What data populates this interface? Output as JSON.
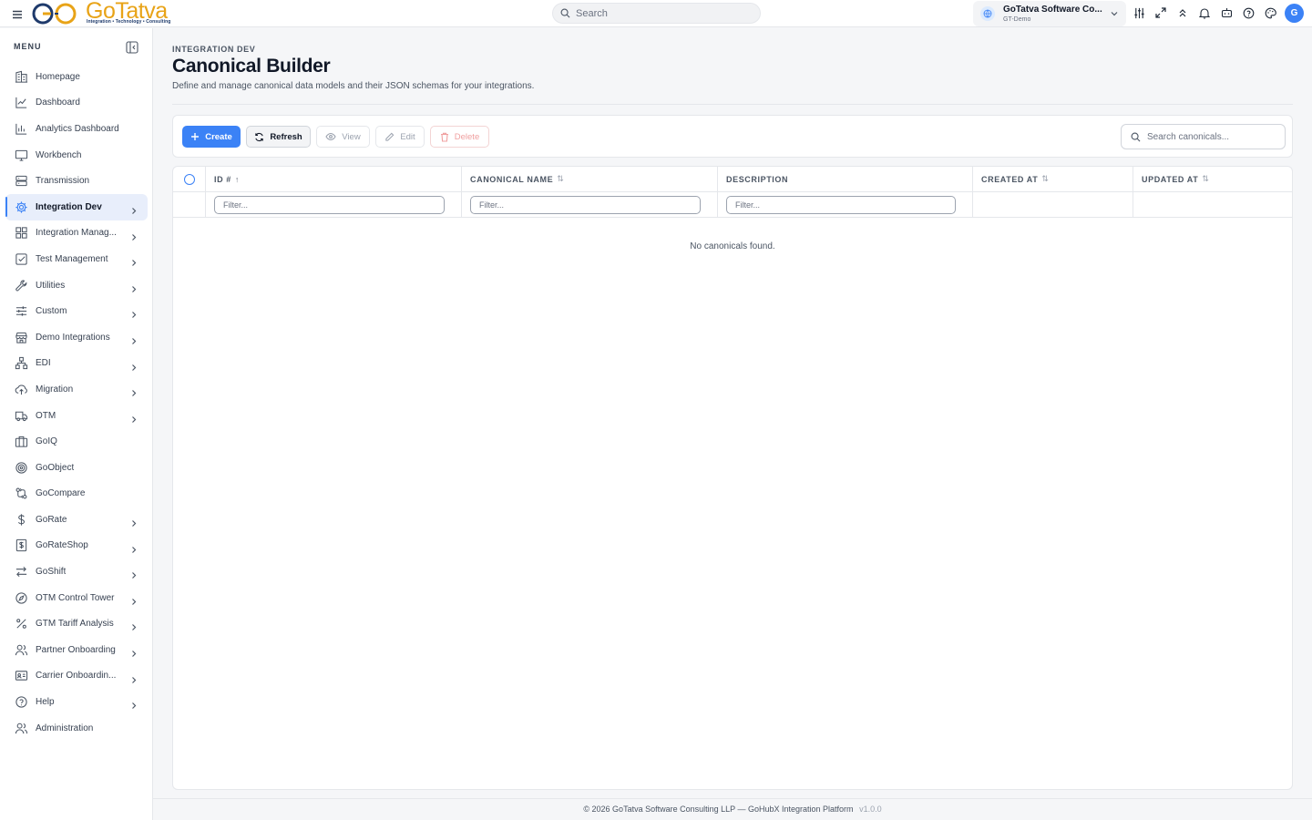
{
  "brand": {
    "name": "GoTatva",
    "tagline": "Integration • Technology • Consulting"
  },
  "header": {
    "search_placeholder": "Search",
    "org_name": "GoTatva Software Co...",
    "org_env": "GT-Demo",
    "avatar_initial": "G",
    "icons": [
      "sliders-icon",
      "expand-icon",
      "chevrons-up-icon",
      "bell-icon",
      "bot-icon",
      "help-icon",
      "palette-icon"
    ]
  },
  "sidebar": {
    "title": "MENU",
    "items": [
      {
        "label": "Homepage",
        "icon": "building-icon",
        "chevron": false,
        "active": false
      },
      {
        "label": "Dashboard",
        "icon": "line-chart-icon",
        "chevron": false,
        "active": false
      },
      {
        "label": "Analytics Dashboard",
        "icon": "bar-chart-icon",
        "chevron": false,
        "active": false
      },
      {
        "label": "Workbench",
        "icon": "monitor-icon",
        "chevron": false,
        "active": false
      },
      {
        "label": "Transmission",
        "icon": "server-icon",
        "chevron": false,
        "active": false
      },
      {
        "label": "Integration Dev",
        "icon": "gear-icon",
        "chevron": true,
        "active": true
      },
      {
        "label": "Integration Manag...",
        "icon": "grid-icon",
        "chevron": true,
        "active": false
      },
      {
        "label": "Test Management",
        "icon": "check-square-icon",
        "chevron": true,
        "active": false
      },
      {
        "label": "Utilities",
        "icon": "wrench-icon",
        "chevron": true,
        "active": false
      },
      {
        "label": "Custom",
        "icon": "sliders-h-icon",
        "chevron": true,
        "active": false
      },
      {
        "label": "Demo Integrations",
        "icon": "store-icon",
        "chevron": true,
        "active": false
      },
      {
        "label": "EDI",
        "icon": "network-icon",
        "chevron": true,
        "active": false
      },
      {
        "label": "Migration",
        "icon": "cloud-upload-icon",
        "chevron": true,
        "active": false
      },
      {
        "label": "OTM",
        "icon": "truck-icon",
        "chevron": true,
        "active": false
      },
      {
        "label": "GoIQ",
        "icon": "briefcase-icon",
        "chevron": false,
        "active": false
      },
      {
        "label": "GoObject",
        "icon": "target-icon",
        "chevron": false,
        "active": false
      },
      {
        "label": "GoCompare",
        "icon": "git-compare-icon",
        "chevron": false,
        "active": false
      },
      {
        "label": "GoRate",
        "icon": "dollar-icon",
        "chevron": true,
        "active": false
      },
      {
        "label": "GoRateShop",
        "icon": "receipt-dollar-icon",
        "chevron": true,
        "active": false
      },
      {
        "label": "GoShift",
        "icon": "arrows-swap-icon",
        "chevron": true,
        "active": false
      },
      {
        "label": "OTM Control Tower",
        "icon": "compass-icon",
        "chevron": true,
        "active": false
      },
      {
        "label": "GTM Tariff Analysis",
        "icon": "percent-icon",
        "chevron": true,
        "active": false
      },
      {
        "label": "Partner Onboarding",
        "icon": "users-icon",
        "chevron": true,
        "active": false
      },
      {
        "label": "Carrier Onboardin...",
        "icon": "id-card-icon",
        "chevron": true,
        "active": false
      },
      {
        "label": "Help",
        "icon": "help-circle-icon",
        "chevron": true,
        "active": false
      },
      {
        "label": "Administration",
        "icon": "users-cog-icon",
        "chevron": false,
        "active": false
      }
    ]
  },
  "page": {
    "breadcrumb": "INTEGRATION DEV",
    "title": "Canonical Builder",
    "description": "Define and manage canonical data models and their JSON schemas for your integrations."
  },
  "toolbar": {
    "create": "Create",
    "refresh": "Refresh",
    "view": "View",
    "edit": "Edit",
    "delete": "Delete",
    "search_placeholder": "Search canonicals..."
  },
  "table": {
    "columns": [
      "ID #",
      "CANONICAL NAME",
      "DESCRIPTION",
      "CREATED AT",
      "UPDATED AT"
    ],
    "filter_placeholder": "Filter...",
    "empty_message": "No canonicals found."
  },
  "footer": {
    "text": "© 2026 GoTatva Software Consulting LLP — GoHubX Integration Platform",
    "version": "v1.0.0"
  },
  "colors": {
    "accent": "#3b82f6",
    "brand_gold": "#e8a317",
    "brand_navy": "#1e3a6b",
    "danger": "#f0a0a0"
  }
}
